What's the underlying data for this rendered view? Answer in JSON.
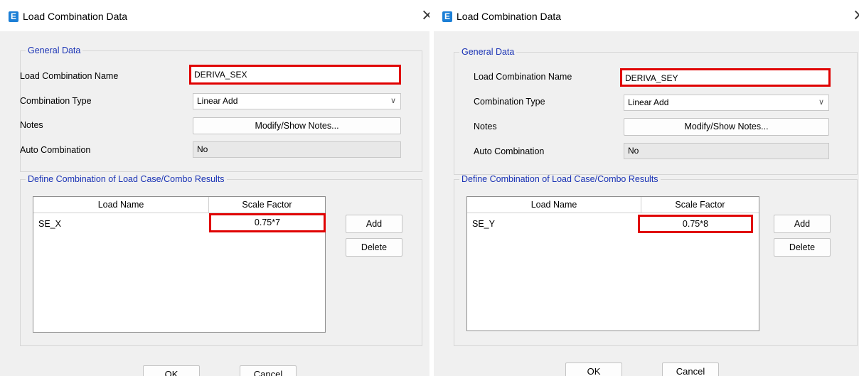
{
  "dialogs": [
    {
      "title": "Load Combination Data",
      "general_data": {
        "legend": "General Data",
        "name_label": "Load Combination Name",
        "name_value": "DERIVA_SEX",
        "type_label": "Combination Type",
        "type_value": "Linear Add",
        "notes_label": "Notes",
        "notes_button": "Modify/Show Notes...",
        "auto_label": "Auto Combination",
        "auto_value": "No"
      },
      "define": {
        "legend": "Define Combination of Load Case/Combo Results",
        "columns": [
          "Load Name",
          "Scale Factor"
        ],
        "rows": [
          {
            "load_name": "SE_X",
            "scale_factor": "0.75*7"
          }
        ],
        "add_button": "Add",
        "delete_button": "Delete"
      },
      "ok_button": "OK",
      "cancel_button": "Cancel"
    },
    {
      "title": "Load Combination Data",
      "general_data": {
        "legend": "General Data",
        "name_label": "Load Combination Name",
        "name_value": "DERIVA_SEY",
        "type_label": "Combination Type",
        "type_value": "Linear Add",
        "notes_label": "Notes",
        "notes_button": "Modify/Show Notes...",
        "auto_label": "Auto Combination",
        "auto_value": "No"
      },
      "define": {
        "legend": "Define Combination of Load Case/Combo Results",
        "columns": [
          "Load Name",
          "Scale Factor"
        ],
        "rows": [
          {
            "load_name": "SE_Y",
            "scale_factor": "0.75*8"
          }
        ],
        "add_button": "Add",
        "delete_button": "Delete"
      },
      "ok_button": "OK",
      "cancel_button": "Cancel"
    }
  ],
  "icons": {
    "app_icon_letter": "E",
    "close_glyph": "×",
    "dropdown_glyph": "∨"
  },
  "colors": {
    "highlight": "#e00000",
    "legend_text": "#1a33b5",
    "app_icon": "#1c7fd6"
  }
}
